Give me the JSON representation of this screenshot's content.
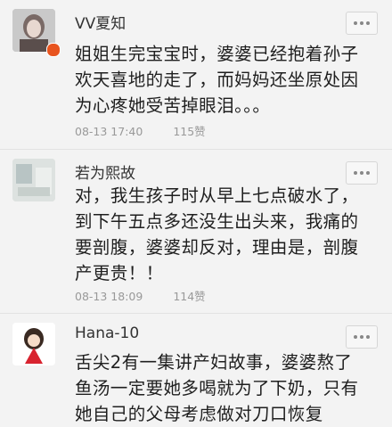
{
  "comments": [
    {
      "username": "VV夏知",
      "text": "姐姐生完宝宝时，婆婆已经抱着孙子欢天喜地的走了，而妈妈还坐原处因为心疼她受苦掉眼泪。。。",
      "timestamp": "08-13 17:40",
      "likes": "115赞"
    },
    {
      "username": "若为熙故",
      "text": "对，我生孩子时从早上七点破水了，到下午五点多还没生出头来，我痛的要剖腹，婆婆却反对，理由是，剖腹产更贵！！",
      "timestamp": "08-13 18:09",
      "likes": "114赞"
    },
    {
      "username": "Hana-10",
      "text": "舌尖2有一集讲产妇故事，婆婆熬了鱼汤一定要她多喝就为了下奶，只有她自己的父母考虑做对刀口恢复",
      "timestamp": "",
      "likes": ""
    }
  ],
  "colors": {
    "background": "#f3f3f3",
    "username": "#333333",
    "meta": "#999999",
    "badge": "#e8541e"
  }
}
